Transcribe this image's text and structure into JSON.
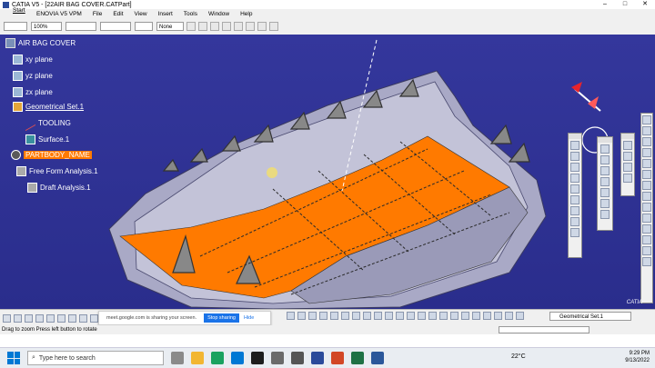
{
  "window": {
    "title": "CATIA V5 - [22AIR BAG COVER.CATPart]",
    "controls": [
      "–",
      "□",
      "✕"
    ]
  },
  "menu": {
    "items": [
      "Start",
      "ENOVIA V5 VPM",
      "File",
      "Edit",
      "View",
      "Insert",
      "Tools",
      "Window",
      "Help"
    ]
  },
  "toolbar": {
    "zoom": "100%",
    "linetype": "None"
  },
  "tree": {
    "root": "AIR BAG COVER",
    "nodes": [
      {
        "label": "xy plane"
      },
      {
        "label": "yz plane"
      },
      {
        "label": "zx plane"
      },
      {
        "label": "Geometrical Set.1"
      },
      {
        "label": "TOOLING"
      },
      {
        "label": "Surface.1"
      },
      {
        "label": "PARTBODY_NAME"
      },
      {
        "label": "Free Form Analysis.1"
      },
      {
        "label": "Draft Analysis.1"
      }
    ]
  },
  "share_bar": {
    "text": "meet.google.com is sharing your screen.",
    "stop": "Stop sharing",
    "hide": "Hide"
  },
  "current_set": "Geometrical Set.1",
  "status": {
    "text": "Drag to zoom   Press left button to rotate"
  },
  "taskbar": {
    "search_placeholder": "Type here to search",
    "weather": "22°C",
    "time": "9:29 PM",
    "date": "9/13/2022"
  },
  "colors": {
    "viewport_bg": "#2f329a",
    "highlight": "#ff7a00",
    "part_surface": "#a9a9c6"
  }
}
